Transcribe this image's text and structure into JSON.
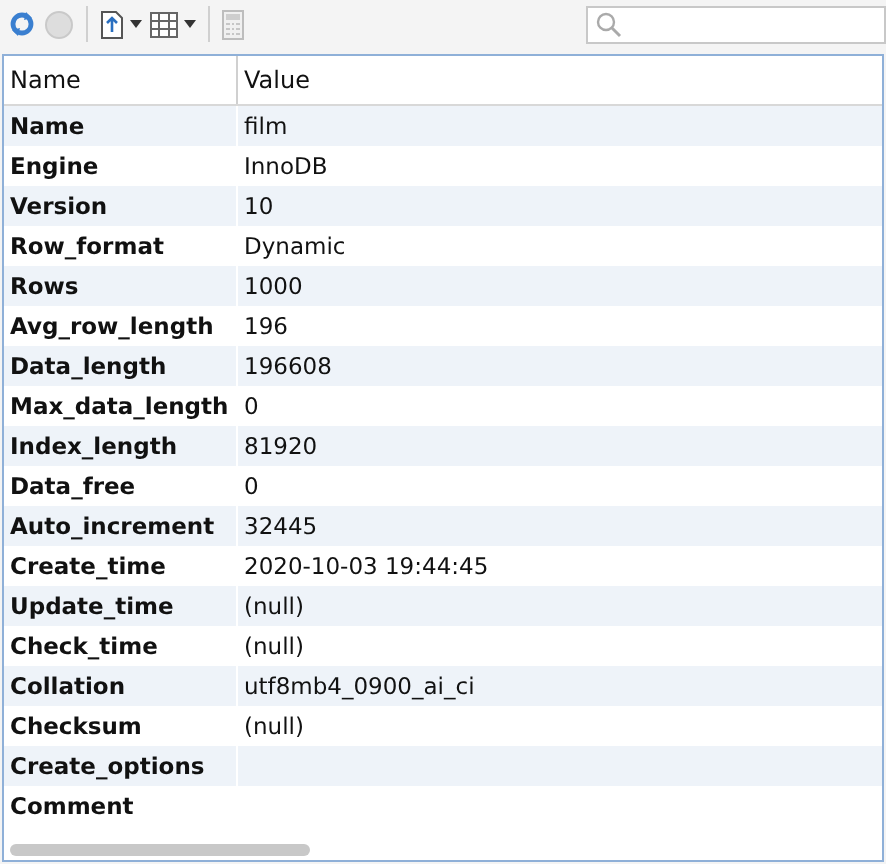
{
  "toolbar": {
    "buttons": [
      {
        "kind": "refresh",
        "disabled": false
      },
      {
        "kind": "stop",
        "disabled": true
      },
      {
        "kind": "export",
        "disabled": false,
        "dropdown": true
      },
      {
        "kind": "grid",
        "disabled": false,
        "dropdown": true
      },
      {
        "kind": "calculator",
        "disabled": true
      }
    ]
  },
  "table": {
    "columns": [
      "Name",
      "Value"
    ],
    "rows": [
      {
        "name": "Name",
        "value": "film"
      },
      {
        "name": "Engine",
        "value": "InnoDB"
      },
      {
        "name": "Version",
        "value": "10"
      },
      {
        "name": "Row_format",
        "value": "Dynamic"
      },
      {
        "name": "Rows",
        "value": "1000"
      },
      {
        "name": "Avg_row_length",
        "value": "196"
      },
      {
        "name": "Data_length",
        "value": "196608"
      },
      {
        "name": "Max_data_length",
        "value": "0"
      },
      {
        "name": "Index_length",
        "value": "81920"
      },
      {
        "name": "Data_free",
        "value": "0"
      },
      {
        "name": "Auto_increment",
        "value": "32445"
      },
      {
        "name": "Create_time",
        "value": "2020-10-03 19:44:45"
      },
      {
        "name": "Update_time",
        "value": "(null)"
      },
      {
        "name": "Check_time",
        "value": "(null)"
      },
      {
        "name": "Collation",
        "value": "utf8mb4_0900_ai_ci"
      },
      {
        "name": "Checksum",
        "value": "(null)"
      },
      {
        "name": "Create_options"
      },
      {
        "name": "Comment"
      }
    ]
  }
}
